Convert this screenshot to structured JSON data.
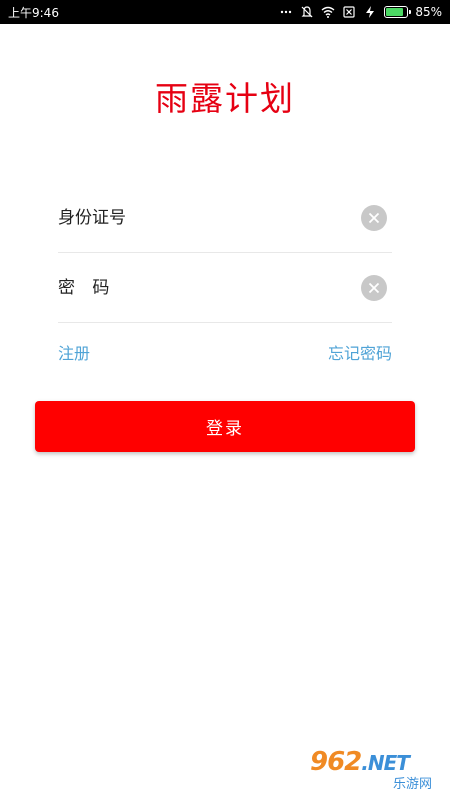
{
  "status_bar": {
    "time": "上午9:46",
    "battery_percent_text": "85%",
    "battery_level": 0.85,
    "icons": [
      "more-dots-icon",
      "mute-icon",
      "wifi-icon",
      "sim-off-icon",
      "charging-icon",
      "battery-icon"
    ]
  },
  "app": {
    "title": "雨露计划"
  },
  "form": {
    "id_field": {
      "placeholder": "身份证号",
      "value": ""
    },
    "password_field": {
      "placeholder": "密 码",
      "value": ""
    },
    "register_link": "注册",
    "forgot_link": "忘记密码",
    "login_button": "登录"
  },
  "watermark": {
    "top_digits": "962",
    "top_suffix": ".NET",
    "bottom": "乐游网"
  },
  "colors": {
    "title_red": "#e60012",
    "button_red": "#ff0000",
    "link_blue": "#4fa3d6",
    "battery_green": "#4cd964"
  }
}
